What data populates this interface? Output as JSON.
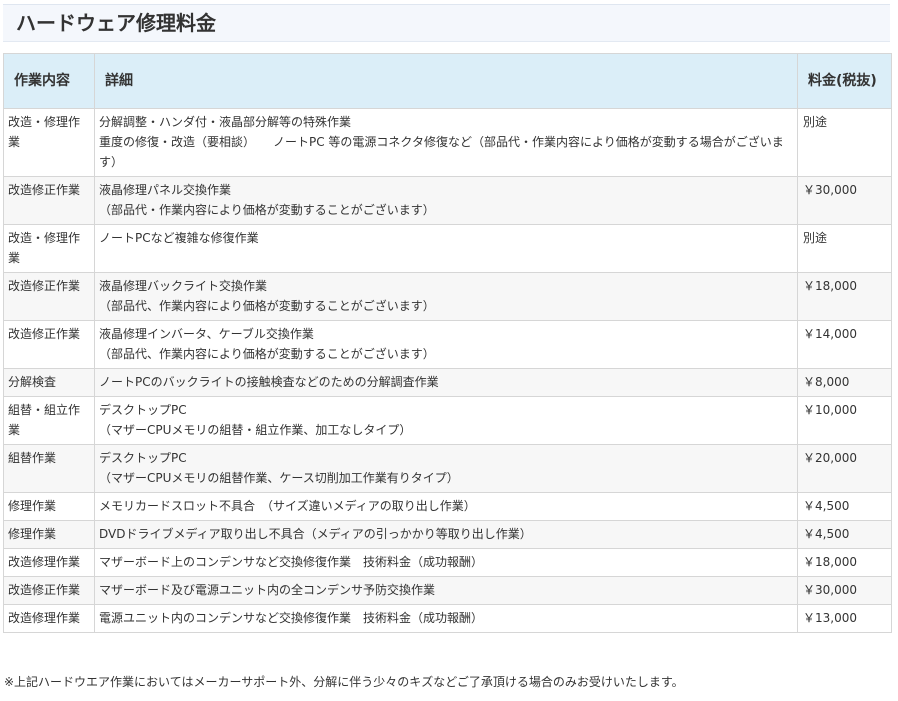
{
  "page": {
    "title": "ハードウェア修理料金"
  },
  "table": {
    "headers": {
      "work": "作業内容",
      "detail": "詳細",
      "price": "料金(税抜)"
    },
    "rows": [
      {
        "work": "改造・修理作業",
        "detail": [
          "分解調整・ハンダ付・液晶部分解等の特殊作業",
          "重度の修復・改造（要相談）　　ノートPC 等の電源コネクタ修復など（部品代・作業内容により価格が変動する場合がございます）"
        ],
        "price": "別途"
      },
      {
        "work": "改造修正作業",
        "detail": [
          "液晶修理パネル交換作業",
          "（部品代・作業内容により価格が変動することがございます）"
        ],
        "price": "￥30,000"
      },
      {
        "work": "改造・修理作業",
        "detail": [
          "ノートPCなど複雑な修復作業"
        ],
        "price": "別途"
      },
      {
        "work": "改造修正作業",
        "detail": [
          "液晶修理バックライト交換作業",
          "（部品代、作業内容により価格が変動することがございます）"
        ],
        "price": "￥18,000"
      },
      {
        "work": "改造修正作業",
        "detail": [
          "液晶修理インバータ、ケーブル交換作業",
          "（部品代、作業内容により価格が変動することがございます）"
        ],
        "price": "￥14,000"
      },
      {
        "work": "分解検査",
        "detail": [
          "ノートPCのバックライトの接触検査などのための分解調査作業"
        ],
        "price": "￥8,000"
      },
      {
        "work": "組替・組立作業",
        "detail": [
          "デスクトップPC",
          "（マザーCPUメモリの組替・組立作業、加工なしタイプ）"
        ],
        "price": "￥10,000"
      },
      {
        "work": "組替作業",
        "detail": [
          "デスクトップPC",
          "（マザーCPUメモリの組替作業、ケース切削加工作業有りタイプ）"
        ],
        "price": "￥20,000"
      },
      {
        "work": "修理作業",
        "detail": [
          "メモリカードスロット不具合　（サイズ違いメディアの取り出し作業）"
        ],
        "price": "￥4,500"
      },
      {
        "work": "修理作業",
        "detail": [
          "DVDドライブメディア取り出し不具合（メディアの引っかかり等取り出し作業）"
        ],
        "price": "￥4,500"
      },
      {
        "work": "改造修理作業",
        "detail": [
          "マザーボード上のコンデンサなど交換修復作業　技術料金（成功報酬）"
        ],
        "price": "￥18,000"
      },
      {
        "work": "改造修正作業",
        "detail": [
          "マザーボード及び電源ユニット内の全コンデンサ予防交換作業"
        ],
        "price": "￥30,000"
      },
      {
        "work": "改造修理作業",
        "detail": [
          "電源ユニット内のコンデンサなど交換修復作業　技術料金（成功報酬）"
        ],
        "price": "￥13,000"
      }
    ]
  },
  "footnote": "※上記ハードウエア作業においてはメーカーサポート外、分解に伴う少々のキズなどご了承頂ける場合のみお受けいたします。",
  "colors": {
    "header_bg": "#dbeef8",
    "title_bg": "#f4f7fc",
    "border": "#d6d6d6",
    "stripe": "#f7f7f7"
  }
}
